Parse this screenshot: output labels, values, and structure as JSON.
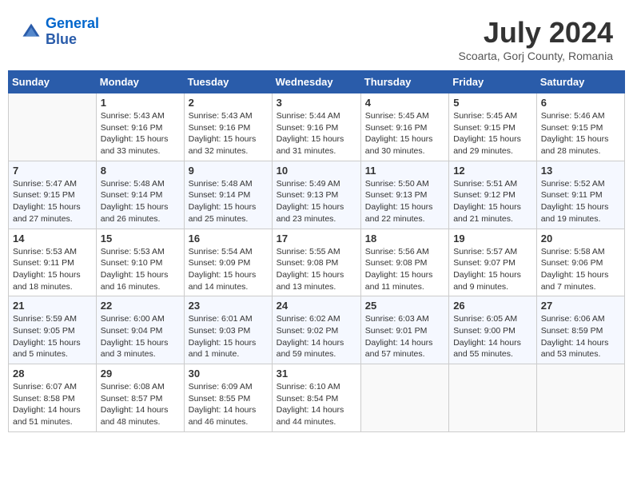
{
  "header": {
    "logo_line1": "General",
    "logo_line2": "Blue",
    "month": "July 2024",
    "location": "Scoarta, Gorj County, Romania"
  },
  "weekdays": [
    "Sunday",
    "Monday",
    "Tuesday",
    "Wednesday",
    "Thursday",
    "Friday",
    "Saturday"
  ],
  "weeks": [
    [
      {
        "day": "",
        "sunrise": "",
        "sunset": "",
        "daylight": ""
      },
      {
        "day": "1",
        "sunrise": "Sunrise: 5:43 AM",
        "sunset": "Sunset: 9:16 PM",
        "daylight": "Daylight: 15 hours and 33 minutes."
      },
      {
        "day": "2",
        "sunrise": "Sunrise: 5:43 AM",
        "sunset": "Sunset: 9:16 PM",
        "daylight": "Daylight: 15 hours and 32 minutes."
      },
      {
        "day": "3",
        "sunrise": "Sunrise: 5:44 AM",
        "sunset": "Sunset: 9:16 PM",
        "daylight": "Daylight: 15 hours and 31 minutes."
      },
      {
        "day": "4",
        "sunrise": "Sunrise: 5:45 AM",
        "sunset": "Sunset: 9:16 PM",
        "daylight": "Daylight: 15 hours and 30 minutes."
      },
      {
        "day": "5",
        "sunrise": "Sunrise: 5:45 AM",
        "sunset": "Sunset: 9:15 PM",
        "daylight": "Daylight: 15 hours and 29 minutes."
      },
      {
        "day": "6",
        "sunrise": "Sunrise: 5:46 AM",
        "sunset": "Sunset: 9:15 PM",
        "daylight": "Daylight: 15 hours and 28 minutes."
      }
    ],
    [
      {
        "day": "7",
        "sunrise": "Sunrise: 5:47 AM",
        "sunset": "Sunset: 9:15 PM",
        "daylight": "Daylight: 15 hours and 27 minutes."
      },
      {
        "day": "8",
        "sunrise": "Sunrise: 5:48 AM",
        "sunset": "Sunset: 9:14 PM",
        "daylight": "Daylight: 15 hours and 26 minutes."
      },
      {
        "day": "9",
        "sunrise": "Sunrise: 5:48 AM",
        "sunset": "Sunset: 9:14 PM",
        "daylight": "Daylight: 15 hours and 25 minutes."
      },
      {
        "day": "10",
        "sunrise": "Sunrise: 5:49 AM",
        "sunset": "Sunset: 9:13 PM",
        "daylight": "Daylight: 15 hours and 23 minutes."
      },
      {
        "day": "11",
        "sunrise": "Sunrise: 5:50 AM",
        "sunset": "Sunset: 9:13 PM",
        "daylight": "Daylight: 15 hours and 22 minutes."
      },
      {
        "day": "12",
        "sunrise": "Sunrise: 5:51 AM",
        "sunset": "Sunset: 9:12 PM",
        "daylight": "Daylight: 15 hours and 21 minutes."
      },
      {
        "day": "13",
        "sunrise": "Sunrise: 5:52 AM",
        "sunset": "Sunset: 9:11 PM",
        "daylight": "Daylight: 15 hours and 19 minutes."
      }
    ],
    [
      {
        "day": "14",
        "sunrise": "Sunrise: 5:53 AM",
        "sunset": "Sunset: 9:11 PM",
        "daylight": "Daylight: 15 hours and 18 minutes."
      },
      {
        "day": "15",
        "sunrise": "Sunrise: 5:53 AM",
        "sunset": "Sunset: 9:10 PM",
        "daylight": "Daylight: 15 hours and 16 minutes."
      },
      {
        "day": "16",
        "sunrise": "Sunrise: 5:54 AM",
        "sunset": "Sunset: 9:09 PM",
        "daylight": "Daylight: 15 hours and 14 minutes."
      },
      {
        "day": "17",
        "sunrise": "Sunrise: 5:55 AM",
        "sunset": "Sunset: 9:08 PM",
        "daylight": "Daylight: 15 hours and 13 minutes."
      },
      {
        "day": "18",
        "sunrise": "Sunrise: 5:56 AM",
        "sunset": "Sunset: 9:08 PM",
        "daylight": "Daylight: 15 hours and 11 minutes."
      },
      {
        "day": "19",
        "sunrise": "Sunrise: 5:57 AM",
        "sunset": "Sunset: 9:07 PM",
        "daylight": "Daylight: 15 hours and 9 minutes."
      },
      {
        "day": "20",
        "sunrise": "Sunrise: 5:58 AM",
        "sunset": "Sunset: 9:06 PM",
        "daylight": "Daylight: 15 hours and 7 minutes."
      }
    ],
    [
      {
        "day": "21",
        "sunrise": "Sunrise: 5:59 AM",
        "sunset": "Sunset: 9:05 PM",
        "daylight": "Daylight: 15 hours and 5 minutes."
      },
      {
        "day": "22",
        "sunrise": "Sunrise: 6:00 AM",
        "sunset": "Sunset: 9:04 PM",
        "daylight": "Daylight: 15 hours and 3 minutes."
      },
      {
        "day": "23",
        "sunrise": "Sunrise: 6:01 AM",
        "sunset": "Sunset: 9:03 PM",
        "daylight": "Daylight: 15 hours and 1 minute."
      },
      {
        "day": "24",
        "sunrise": "Sunrise: 6:02 AM",
        "sunset": "Sunset: 9:02 PM",
        "daylight": "Daylight: 14 hours and 59 minutes."
      },
      {
        "day": "25",
        "sunrise": "Sunrise: 6:03 AM",
        "sunset": "Sunset: 9:01 PM",
        "daylight": "Daylight: 14 hours and 57 minutes."
      },
      {
        "day": "26",
        "sunrise": "Sunrise: 6:05 AM",
        "sunset": "Sunset: 9:00 PM",
        "daylight": "Daylight: 14 hours and 55 minutes."
      },
      {
        "day": "27",
        "sunrise": "Sunrise: 6:06 AM",
        "sunset": "Sunset: 8:59 PM",
        "daylight": "Daylight: 14 hours and 53 minutes."
      }
    ],
    [
      {
        "day": "28",
        "sunrise": "Sunrise: 6:07 AM",
        "sunset": "Sunset: 8:58 PM",
        "daylight": "Daylight: 14 hours and 51 minutes."
      },
      {
        "day": "29",
        "sunrise": "Sunrise: 6:08 AM",
        "sunset": "Sunset: 8:57 PM",
        "daylight": "Daylight: 14 hours and 48 minutes."
      },
      {
        "day": "30",
        "sunrise": "Sunrise: 6:09 AM",
        "sunset": "Sunset: 8:55 PM",
        "daylight": "Daylight: 14 hours and 46 minutes."
      },
      {
        "day": "31",
        "sunrise": "Sunrise: 6:10 AM",
        "sunset": "Sunset: 8:54 PM",
        "daylight": "Daylight: 14 hours and 44 minutes."
      },
      {
        "day": "",
        "sunrise": "",
        "sunset": "",
        "daylight": ""
      },
      {
        "day": "",
        "sunrise": "",
        "sunset": "",
        "daylight": ""
      },
      {
        "day": "",
        "sunrise": "",
        "sunset": "",
        "daylight": ""
      }
    ]
  ]
}
